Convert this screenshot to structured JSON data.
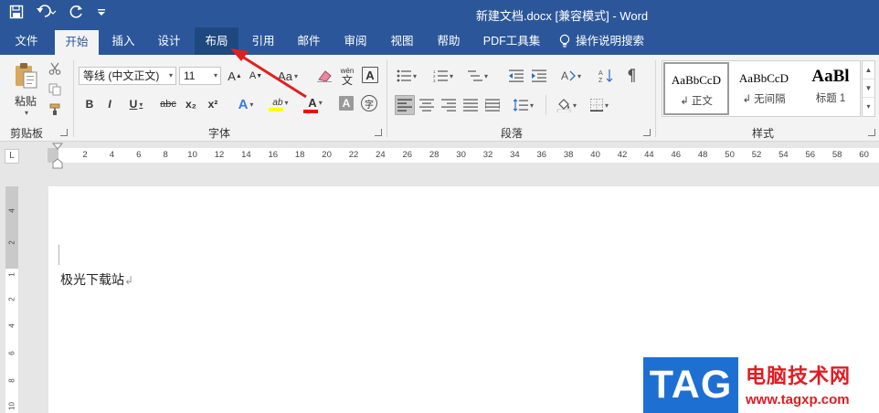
{
  "title_bar": {
    "qat_icons": [
      "save-icon",
      "undo-icon",
      "redo-icon",
      "customize-icon"
    ],
    "title": "新建文档.docx [兼容模式]  -  Word"
  },
  "tabs": [
    {
      "label": "文件",
      "state": "normal"
    },
    {
      "label": "开始",
      "state": "active"
    },
    {
      "label": "插入",
      "state": "normal"
    },
    {
      "label": "设计",
      "state": "normal"
    },
    {
      "label": "布局",
      "state": "hover"
    },
    {
      "label": "引用",
      "state": "normal"
    },
    {
      "label": "邮件",
      "state": "normal"
    },
    {
      "label": "审阅",
      "state": "normal"
    },
    {
      "label": "视图",
      "state": "normal"
    },
    {
      "label": "帮助",
      "state": "normal"
    },
    {
      "label": "PDF工具集",
      "state": "normal"
    },
    {
      "label": "操作说明搜索",
      "state": "normal",
      "icon": "lightbulb-icon"
    }
  ],
  "ribbon": {
    "clipboard": {
      "label": "剪贴板",
      "paste_label": "粘贴"
    },
    "font": {
      "label": "字体",
      "font_name": "等线 (中文正文)",
      "font_size": "11",
      "grow": "A",
      "shrink": "A",
      "case": "Aa",
      "phonetic_top": "wén",
      "phonetic_char": "文",
      "border_char": "A",
      "bold": "B",
      "italic": "I",
      "underline": "U",
      "strike": "abc",
      "sub": "x₂",
      "sup": "x²",
      "effects": "A",
      "highlight": "ab",
      "color": "A",
      "shade_char": "A",
      "enclose_char": "字"
    },
    "paragraph": {
      "label": "段落"
    },
    "styles": {
      "label": "样式",
      "items": [
        {
          "sample": "AaBbCcD",
          "name": "↲ 正文"
        },
        {
          "sample": "AaBbCcD",
          "name": "↲ 无间隔"
        },
        {
          "sample": "AaBl",
          "name": "标题 1"
        }
      ]
    }
  },
  "ruler": {
    "corner": "L",
    "h_numbers": [
      "2",
      "4",
      "6",
      "8",
      "10",
      "12",
      "14",
      "16",
      "18",
      "20",
      "22",
      "24",
      "26",
      "28",
      "30",
      "32",
      "34",
      "36",
      "38",
      "40",
      "42",
      "44",
      "46",
      "48",
      "50",
      "52",
      "54",
      "56",
      "58",
      "60"
    ],
    "v_numbers": [
      "4",
      "2",
      "1",
      "2",
      "4",
      "6",
      "8",
      "10"
    ]
  },
  "document": {
    "text": "极光下载站",
    "para_mark": "↲"
  },
  "annotation": {
    "color": "#e02020",
    "target": "布局"
  },
  "watermark": {
    "tag": "TAG",
    "site_name": "电脑技术网",
    "url": "www.tagxp.com"
  },
  "colors": {
    "title_bar": "#2b579a",
    "ribbon_bg": "#f3f3f3",
    "highlight_bar": "#ffff00",
    "font_color_bar": "#ff0000"
  }
}
